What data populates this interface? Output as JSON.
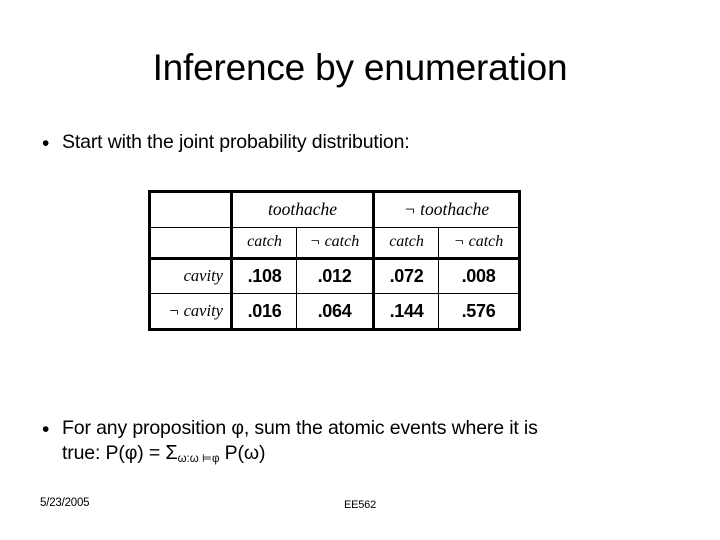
{
  "slide": {
    "title": "Inference by enumeration",
    "bullet_marker": "•"
  },
  "bullets": [
    {
      "text": "Start with the joint probability distribution:"
    },
    {
      "line1": "For any proposition φ, sum the atomic events where it is",
      "line2_prefix": "true: P(φ) = ",
      "sum_symbol": "Σ",
      "sum_subscript": "ω:ω ⊨φ",
      "line2_suffix": " P(ω)"
    }
  ],
  "joint_table": {
    "corner_label": "",
    "top_headers": [
      "toothache",
      "¬ toothache"
    ],
    "sub_headers": [
      "catch",
      "¬ catch",
      "catch",
      "¬ catch"
    ],
    "row_labels": [
      "cavity",
      "¬ cavity"
    ],
    "rows": [
      [
        ".108",
        ".012",
        ".072",
        ".008"
      ],
      [
        ".016",
        ".064",
        ".144",
        ".576"
      ]
    ]
  },
  "footer": {
    "date": "5/23/2005",
    "course": "EE562"
  },
  "colors": {
    "background": "#ffffff",
    "text": "#000000",
    "table_border": "#000000"
  }
}
